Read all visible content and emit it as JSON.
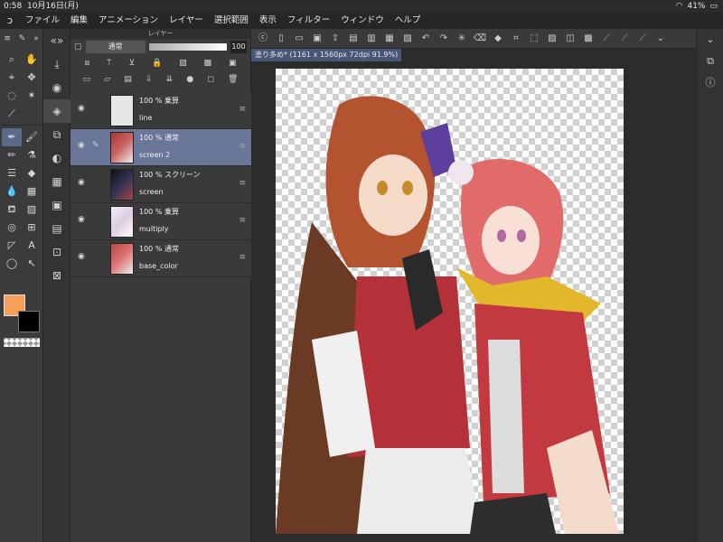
{
  "status": {
    "time": "0:58",
    "date": "10月16日(月)",
    "battery": "41%"
  },
  "menu": [
    "ファイル",
    "編集",
    "アニメーション",
    "レイヤー",
    "選択範囲",
    "表示",
    "フィルター",
    "ウィンドウ",
    "ヘルプ"
  ],
  "layer_panel": {
    "title": "レイヤー",
    "blend_mode": "通常",
    "opacity": "100",
    "layers": [
      {
        "meta": "100 % 乗算",
        "name": "line",
        "selected": false
      },
      {
        "meta": "100 % 通常",
        "name": "screen 2",
        "selected": true
      },
      {
        "meta": "100 % スクリーン",
        "name": "screen",
        "selected": false
      },
      {
        "meta": "100 % 乗算",
        "name": "multiply",
        "selected": false
      },
      {
        "meta": "100 % 通常",
        "name": "base_color",
        "selected": false
      }
    ]
  },
  "document": {
    "tab_title": "塗り多め* (1161 x 1560px 72dpi 91.9%)"
  },
  "colors": {
    "main": "#f7a05a",
    "sub": "#000000",
    "accent": "#6b7799"
  }
}
